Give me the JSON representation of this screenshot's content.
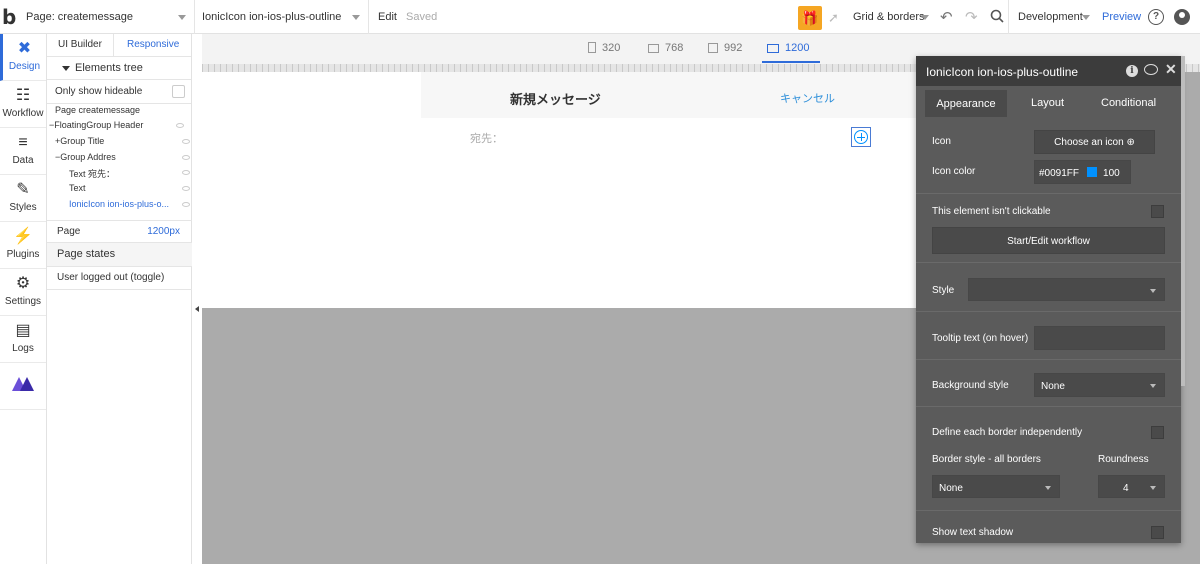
{
  "topbar": {
    "page_label": "Page: createmessage",
    "element_label": "IonicIcon ion-ios-plus-outline",
    "edit": "Edit",
    "saved": "Saved",
    "grid": "Grid & borders",
    "dev": "Development",
    "preview": "Preview",
    "help": "?"
  },
  "leftnav": {
    "items": [
      {
        "label": "Design",
        "icon": "design-icon"
      },
      {
        "label": "Workflow",
        "icon": "workflow-icon"
      },
      {
        "label": "Data",
        "icon": "data-icon"
      },
      {
        "label": "Styles",
        "icon": "styles-icon"
      },
      {
        "label": "Plugins",
        "icon": "plugins-icon"
      },
      {
        "label": "Settings",
        "icon": "settings-icon"
      },
      {
        "label": "Logs",
        "icon": "logs-icon"
      }
    ]
  },
  "panel": {
    "tab_builder": "UI Builder",
    "tab_responsive": "Responsive",
    "elements_tree": "Elements tree",
    "only_hideable": "Only show hideable",
    "tree": [
      "Page createmessage",
      "FloatingGroup Header",
      "Group Title",
      "Group Addres",
      "Text 宛先：",
      "Text",
      "IonicIcon ion-ios-plus-o..."
    ],
    "page_label": "Page",
    "page_value": "1200px",
    "page_states": "Page states",
    "logged_out": "User logged out (toggle)"
  },
  "canvas": {
    "viewports": [
      "320",
      "768",
      "992",
      "1200"
    ],
    "title": "新規メッセージ",
    "cancel": "キャンセル",
    "to": "宛先："
  },
  "props": {
    "title": "IonicIcon ion-ios-plus-outline",
    "tabs": [
      "Appearance",
      "Layout",
      "Conditional"
    ],
    "icon_label": "Icon",
    "choose_icon": "Choose an icon",
    "icon_color_label": "Icon color",
    "icon_color_hex": "#0091FF",
    "icon_opacity": "100",
    "not_clickable": "This element isn't clickable",
    "workflow_btn": "Start/Edit workflow",
    "style_label": "Style",
    "tooltip_label": "Tooltip text (on hover)",
    "bg_style_label": "Background style",
    "bg_style_value": "None",
    "define_border": "Define each border independently",
    "border_style_label": "Border style - all borders",
    "roundness_label": "Roundness",
    "border_value": "None",
    "roundness_value": "4",
    "shadow_label": "Show text shadow"
  },
  "colors": {
    "accent": "#2e6bd9",
    "icon_color": "#0091FF",
    "gift": "#f5a623",
    "panel_dark": "#5b5b5b"
  }
}
